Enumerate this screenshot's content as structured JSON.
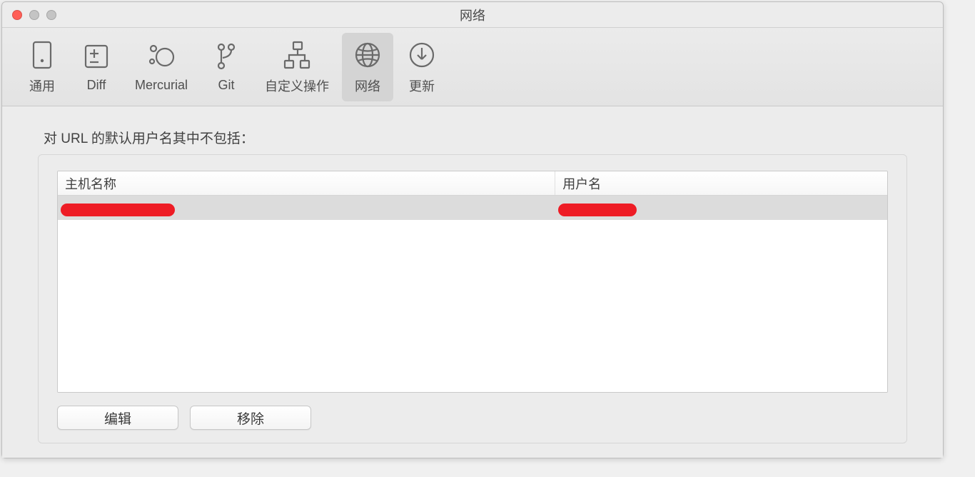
{
  "window": {
    "title": "网络"
  },
  "toolbar": {
    "tabs": [
      {
        "label": "通用",
        "icon": "general-icon",
        "active": false
      },
      {
        "label": "Diff",
        "icon": "diff-icon",
        "active": false
      },
      {
        "label": "Mercurial",
        "icon": "mercurial-icon",
        "active": false
      },
      {
        "label": "Git",
        "icon": "git-icon",
        "active": false
      },
      {
        "label": "自定义操作",
        "icon": "custom-icon",
        "active": false
      },
      {
        "label": "网络",
        "icon": "network-icon",
        "active": true
      },
      {
        "label": "更新",
        "icon": "update-icon",
        "active": false
      }
    ]
  },
  "section": {
    "label": "对 URL 的默认用户名其中不包括："
  },
  "table": {
    "headers": {
      "host": "主机名称",
      "user": "用户名"
    },
    "rows": [
      {
        "host": "[redacted]",
        "user": "[redacted]",
        "selected": true
      }
    ]
  },
  "buttons": {
    "edit": "编辑",
    "remove": "移除"
  }
}
